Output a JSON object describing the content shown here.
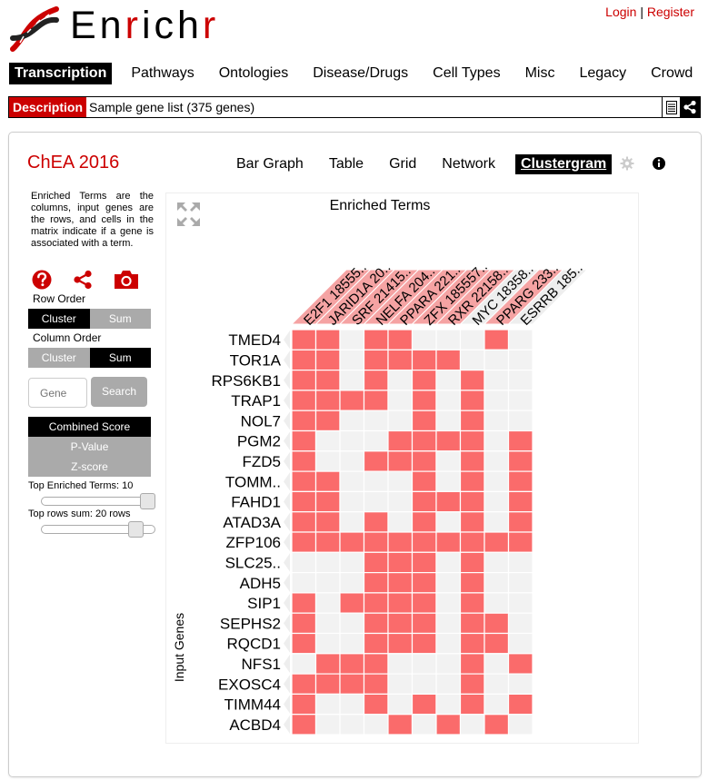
{
  "brand": {
    "name_parts": [
      "En",
      "r",
      "ich",
      "r"
    ]
  },
  "auth": {
    "login": "Login",
    "separator": "|",
    "register": "Register"
  },
  "nav": {
    "items": [
      "Transcription",
      "Pathways",
      "Ontologies",
      "Disease/Drugs",
      "Cell Types",
      "Misc",
      "Legacy",
      "Crowd"
    ],
    "active": "Transcription"
  },
  "description": {
    "label": "Description",
    "text": "Sample gene list (375 genes)"
  },
  "library": {
    "title": "ChEA 2016"
  },
  "views": {
    "items": [
      "Bar Graph",
      "Table",
      "Grid",
      "Network",
      "Clustergram"
    ],
    "active": "Clustergram"
  },
  "sidebar": {
    "description": "Enriched Terms are the columns, input genes are the rows, and cells in the matrix indicate if a gene is associated with a term.",
    "row_order_label": "Row Order",
    "row_order": {
      "options": [
        "Cluster",
        "Sum"
      ],
      "selected": "Cluster"
    },
    "column_order_label": "Column Order",
    "column_order": {
      "options": [
        "Cluster",
        "Sum"
      ],
      "selected": "Sum"
    },
    "search_placeholder": "Gene",
    "search_button": "Search",
    "score_buttons": [
      "Combined Score",
      "P-Value",
      "Z-score"
    ],
    "score_selected": "Combined Score",
    "top_terms_label": "Top Enriched Terms: 10",
    "top_terms_fraction": 1.0,
    "top_rows_label": "Top rows sum: 20 rows",
    "top_rows_fraction": 0.88
  },
  "clustergram": {
    "title": "Enriched Terms",
    "row_axis_label": "Input Genes",
    "columns": [
      "E2F1 18555..",
      "JARID1A 20..",
      "SRF 21415..",
      "NELFA 204..",
      "PPARA 221..",
      "ZFX 185557..",
      "RXR 22158..",
      "MYC 18358..",
      "PPARG 233..",
      "ESRRB 185.."
    ],
    "rows": [
      "TMED4",
      "TOR1A",
      "RPS6KB1",
      "TRAP1",
      "NOL7",
      "PGM2",
      "FZD5",
      "TOMM..",
      "FAHD1",
      "ATAD3A",
      "ZFP106",
      "SLC25..",
      "ADH5",
      "SIP1",
      "SEPHS2",
      "RQCD1",
      "NFS1",
      "EXOSC4",
      "TIMM44",
      "ACBD4"
    ],
    "matrix": [
      [
        1,
        1,
        0,
        1,
        1,
        0,
        0,
        0,
        1,
        0
      ],
      [
        1,
        1,
        0,
        1,
        1,
        1,
        1,
        0,
        0,
        0
      ],
      [
        1,
        1,
        0,
        1,
        0,
        1,
        0,
        1,
        0,
        0
      ],
      [
        1,
        1,
        1,
        1,
        0,
        1,
        0,
        1,
        0,
        0
      ],
      [
        1,
        1,
        0,
        0,
        0,
        1,
        0,
        1,
        0,
        0
      ],
      [
        1,
        0,
        0,
        0,
        1,
        1,
        1,
        1,
        0,
        1
      ],
      [
        1,
        0,
        0,
        1,
        1,
        1,
        0,
        1,
        0,
        1
      ],
      [
        1,
        1,
        0,
        0,
        0,
        1,
        0,
        1,
        0,
        1
      ],
      [
        1,
        1,
        0,
        0,
        0,
        1,
        1,
        1,
        0,
        1
      ],
      [
        1,
        1,
        0,
        1,
        0,
        1,
        0,
        1,
        0,
        1
      ],
      [
        1,
        1,
        1,
        1,
        1,
        1,
        1,
        1,
        1,
        1
      ],
      [
        0,
        0,
        0,
        1,
        1,
        1,
        0,
        1,
        0,
        0
      ],
      [
        0,
        0,
        0,
        1,
        1,
        1,
        0,
        1,
        0,
        0
      ],
      [
        1,
        0,
        1,
        1,
        1,
        1,
        0,
        1,
        0,
        0
      ],
      [
        1,
        0,
        0,
        1,
        1,
        1,
        0,
        1,
        1,
        0
      ],
      [
        1,
        0,
        0,
        1,
        1,
        1,
        0,
        1,
        1,
        0
      ],
      [
        0,
        1,
        1,
        1,
        0,
        0,
        0,
        1,
        0,
        1
      ],
      [
        1,
        1,
        1,
        1,
        0,
        0,
        0,
        1,
        0,
        0
      ],
      [
        1,
        0,
        0,
        1,
        0,
        1,
        0,
        1,
        0,
        1
      ],
      [
        1,
        0,
        0,
        0,
        1,
        0,
        1,
        0,
        1,
        0
      ]
    ],
    "column_highlight": [
      1,
      1,
      1,
      1,
      1,
      1,
      1,
      0,
      1,
      0
    ],
    "on_color": "#fa6b6b",
    "off_color": "#f2f2f2"
  },
  "colors": {
    "brand_red": "#cc0000",
    "active_bg": "#000000",
    "inactive_bg": "#aaaaaa"
  }
}
